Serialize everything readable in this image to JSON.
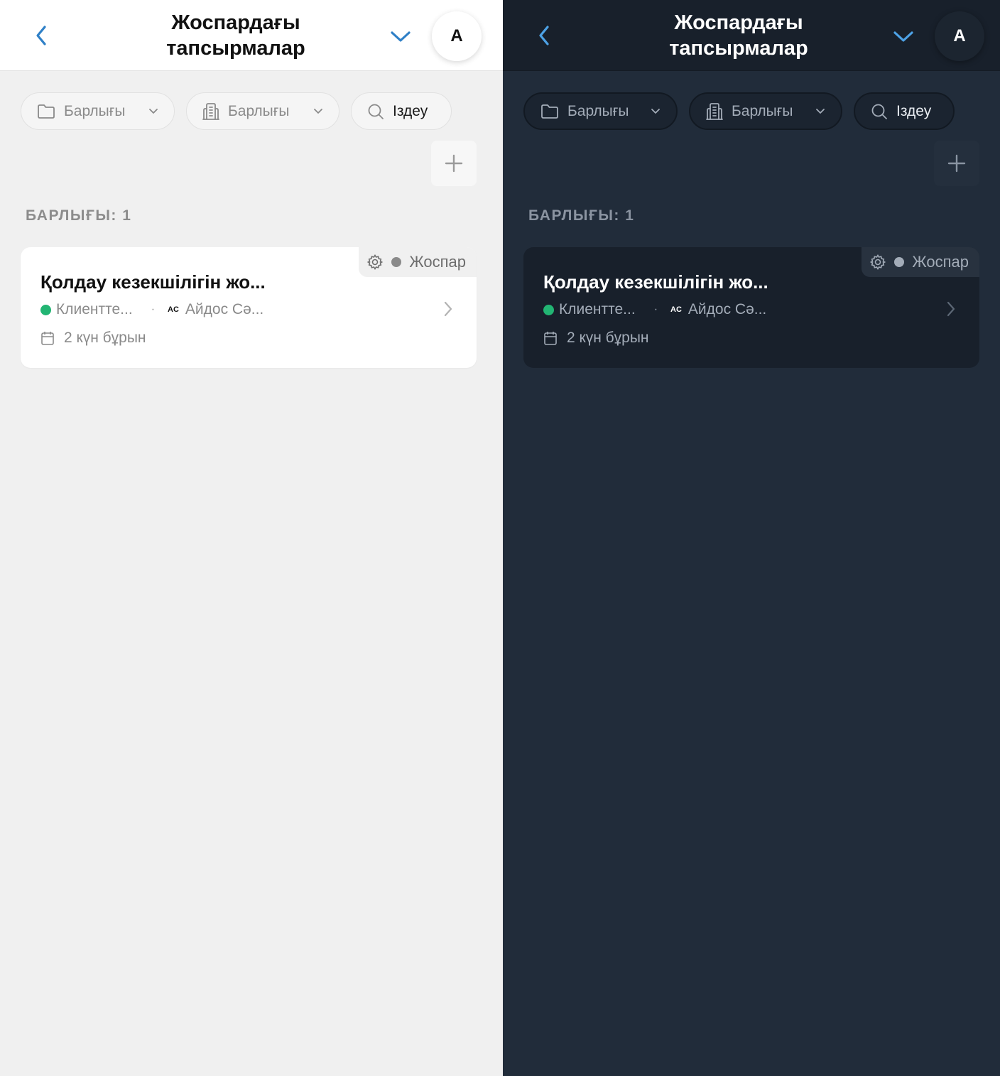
{
  "colors": {
    "accent": "#2f80c7",
    "accent_dark": "#4da2e6",
    "status_green": "#22b573",
    "status_gray": "#8a8a8a"
  },
  "panels": [
    {
      "theme": "light",
      "header": {
        "title": "Жоспардағы тапсырмалар",
        "avatar_initial": "A"
      },
      "filters": {
        "folder_label": "Барлығы",
        "building_label": "Барлығы",
        "search_label": "Іздеу"
      },
      "count_label": "БАРЛЫҒЫ: 1",
      "task": {
        "title": "Қолдау кезекшілігін жо...",
        "status": "Жоспар",
        "channel": "Клиентте...",
        "separator": "·",
        "assignee_initials": "AC",
        "assignee": "Айдос Сә...",
        "time": "2 күн бұрын"
      }
    },
    {
      "theme": "dark",
      "header": {
        "title": "Жоспардағы тапсырмалар",
        "avatar_initial": "A"
      },
      "filters": {
        "folder_label": "Барлығы",
        "building_label": "Барлығы",
        "search_label": "Іздеу"
      },
      "count_label": "БАРЛЫҒЫ: 1",
      "task": {
        "title": "Қолдау кезекшілігін жо...",
        "status": "Жоспар",
        "channel": "Клиентте...",
        "separator": "·",
        "assignee_initials": "AC",
        "assignee": "Айдос Сә...",
        "time": "2 күн бұрын"
      }
    }
  ]
}
